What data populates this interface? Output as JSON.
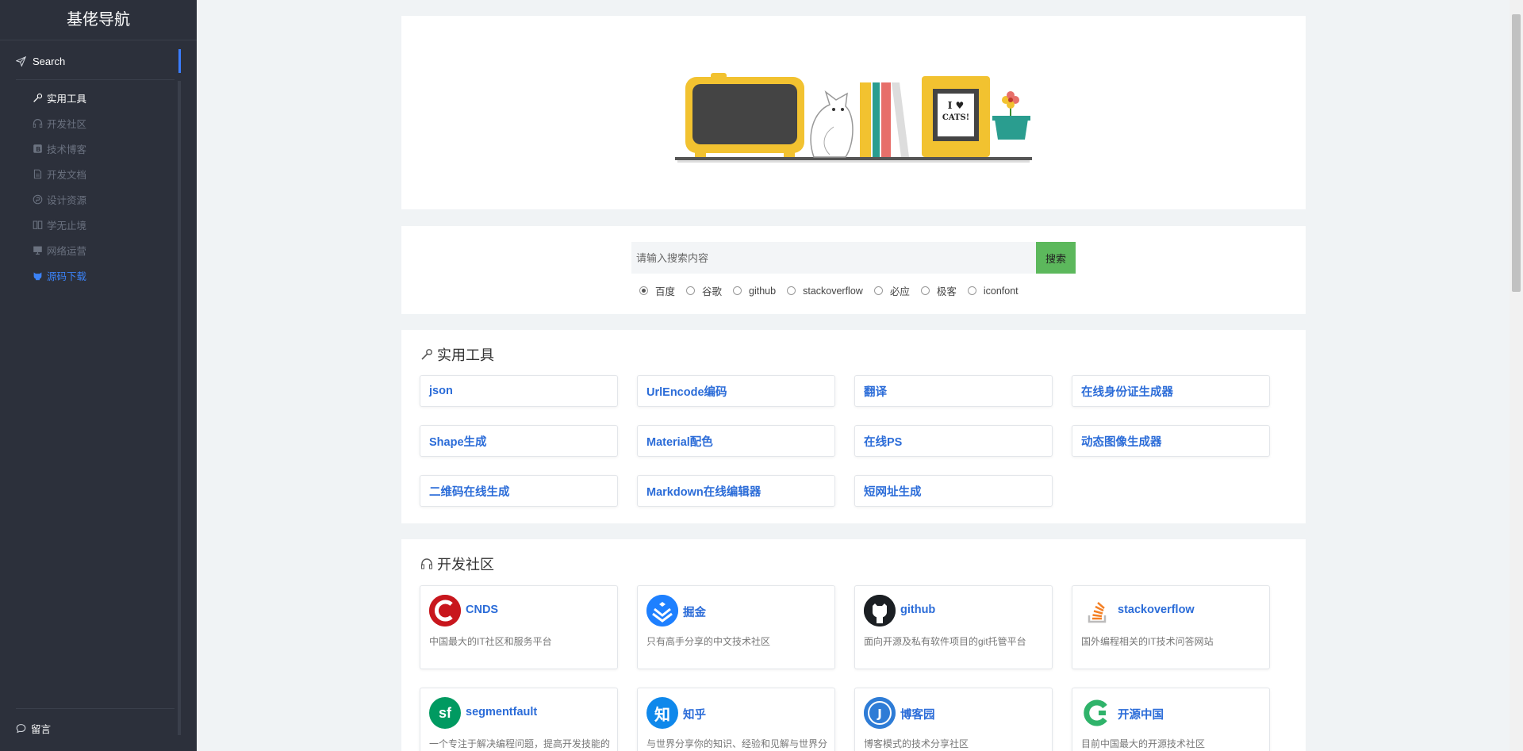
{
  "sidebar": {
    "logo": "基佬导航",
    "search_label": "Search",
    "items": [
      {
        "label": "实用工具"
      },
      {
        "label": "开发社区"
      },
      {
        "label": "技术博客"
      },
      {
        "label": "开发文档"
      },
      {
        "label": "设计资源"
      },
      {
        "label": "学无止境"
      },
      {
        "label": "网络运营"
      },
      {
        "label": "源码下载"
      }
    ],
    "message_label": "留言"
  },
  "banner": {
    "sign_line1": "I ♥",
    "sign_line2": "CATS!"
  },
  "search": {
    "placeholder": "请输入搜索内容",
    "button_label": "搜索",
    "engines": [
      "百度",
      "谷歌",
      "github",
      "stackoverflow",
      "必应",
      "极客",
      "iconfont"
    ],
    "selected_engine": "百度"
  },
  "tools": {
    "title": "实用工具",
    "items": [
      {
        "label": "json"
      },
      {
        "label": "UrlEncode编码"
      },
      {
        "label": "翻译"
      },
      {
        "label": "在线身份证生成器"
      },
      {
        "label": "Shape生成"
      },
      {
        "label": "Material配色"
      },
      {
        "label": "在线PS"
      },
      {
        "label": "动态图像生成器"
      },
      {
        "label": "二维码在线生成"
      },
      {
        "label": "Markdown在线编辑器"
      },
      {
        "label": "短网址生成"
      }
    ]
  },
  "community": {
    "title": "开发社区",
    "items": [
      {
        "name": "CNDS",
        "desc": "中国最大的IT社区和服务平台",
        "color": "#c8161d",
        "icon": "cnds-logo-icon"
      },
      {
        "name": "掘金",
        "desc": "只有高手分享的中文技术社区",
        "color": "#1e80ff",
        "icon": "juejin-logo-icon"
      },
      {
        "name": "github",
        "desc": "面向开源及私有软件项目的git托管平台",
        "color": "#1b1f23",
        "icon": "github-logo-icon"
      },
      {
        "name": "stackoverflow",
        "desc": "国外编程相关的IT技术问答网站",
        "color": "#f48024",
        "icon": "stackoverflow-logo-icon"
      },
      {
        "name": "segmentfault",
        "desc": "一个专注于解决编程问题，提高开发技能的",
        "color": "#009a61",
        "icon": "segmentfault-logo-icon"
      },
      {
        "name": "知乎",
        "desc": "与世界分享你的知识、经验和见解与世界分",
        "color": "#0f88eb",
        "icon": "zhihu-logo-icon"
      },
      {
        "name": "博客园",
        "desc": "博客模式的技术分享社区",
        "color": "#2e7cd6",
        "icon": "cnblogs-logo-icon"
      },
      {
        "name": "开源中国",
        "desc": "目前中国最大的开源技术社区",
        "color": "#2fb36a",
        "icon": "oschina-logo-icon"
      }
    ]
  },
  "colors": {
    "sidebar_bg": "#2c303b",
    "accent": "#3a7dff",
    "link": "#2b6cd8",
    "search_button": "#5cb85c"
  }
}
